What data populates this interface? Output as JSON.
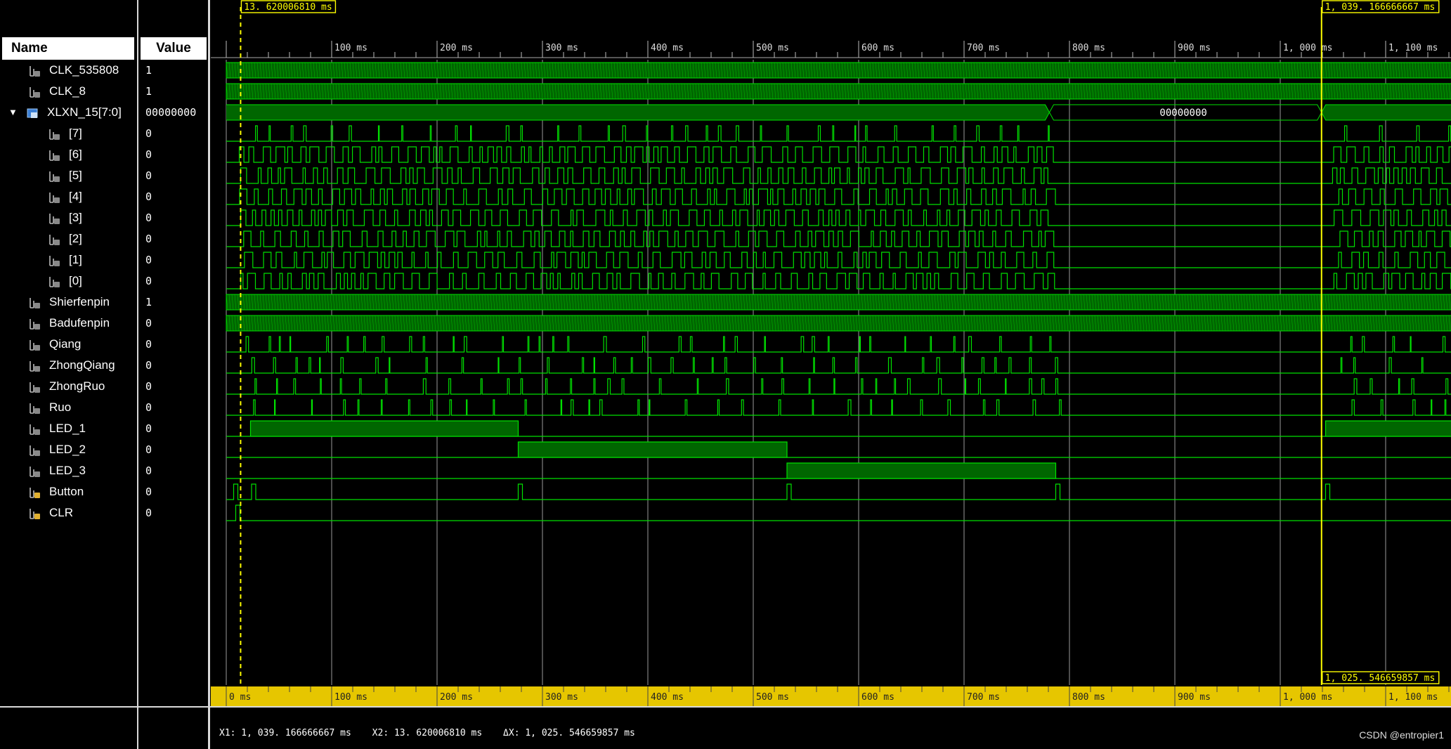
{
  "headers": {
    "name": "Name",
    "value": "Value"
  },
  "signals": [
    {
      "name": "CLK_535808",
      "value": "1",
      "indent": 0,
      "kind": "bit",
      "wave": "clock"
    },
    {
      "name": "CLK_8",
      "value": "1",
      "indent": 0,
      "kind": "bit",
      "wave": "clock"
    },
    {
      "name": "XLXN_15[7:0]",
      "value": "00000000",
      "indent": -1,
      "kind": "bus",
      "wave": "bus",
      "expanded": true
    },
    {
      "name": "[7]",
      "value": "0",
      "indent": 1,
      "kind": "bit",
      "wave": "sparse"
    },
    {
      "name": "[6]",
      "value": "0",
      "indent": 1,
      "kind": "bit",
      "wave": "pulses"
    },
    {
      "name": "[5]",
      "value": "0",
      "indent": 1,
      "kind": "bit",
      "wave": "pulses"
    },
    {
      "name": "[4]",
      "value": "0",
      "indent": 1,
      "kind": "bit",
      "wave": "pulses"
    },
    {
      "name": "[3]",
      "value": "0",
      "indent": 1,
      "kind": "bit",
      "wave": "pulses"
    },
    {
      "name": "[2]",
      "value": "0",
      "indent": 1,
      "kind": "bit",
      "wave": "pulses"
    },
    {
      "name": "[1]",
      "value": "0",
      "indent": 1,
      "kind": "bit",
      "wave": "pulses"
    },
    {
      "name": "[0]",
      "value": "0",
      "indent": 1,
      "kind": "bit",
      "wave": "pulses"
    },
    {
      "name": "Shierfenpin",
      "value": "1",
      "indent": 0,
      "kind": "bit",
      "wave": "clock"
    },
    {
      "name": "Badufenpin",
      "value": "0",
      "indent": 0,
      "kind": "bit",
      "wave": "clock"
    },
    {
      "name": "Qiang",
      "value": "0",
      "indent": 0,
      "kind": "bit",
      "wave": "sparse"
    },
    {
      "name": "ZhongQiang",
      "value": "0",
      "indent": 0,
      "kind": "bit",
      "wave": "sparse"
    },
    {
      "name": "ZhongRuo",
      "value": "0",
      "indent": 0,
      "kind": "bit",
      "wave": "sparse"
    },
    {
      "name": "Ruo",
      "value": "0",
      "indent": 0,
      "kind": "bit",
      "wave": "sparse"
    },
    {
      "name": "LED_1",
      "value": "0",
      "indent": 0,
      "kind": "bit",
      "wave": "led1"
    },
    {
      "name": "LED_2",
      "value": "0",
      "indent": 0,
      "kind": "bit",
      "wave": "led2"
    },
    {
      "name": "LED_3",
      "value": "0",
      "indent": 0,
      "kind": "bit",
      "wave": "led3"
    },
    {
      "name": "Button",
      "value": "0",
      "indent": 0,
      "kind": "input",
      "wave": "button"
    },
    {
      "name": "CLR",
      "value": "0",
      "indent": 0,
      "kind": "input",
      "wave": "clr"
    }
  ],
  "timeline": {
    "tick_labels": [
      "0 ms",
      "100 ms",
      "200 ms",
      "300 ms",
      "400 ms",
      "500 ms",
      "600 ms",
      "700 ms",
      "800 ms",
      "900 ms",
      "1, 000 ms",
      "1, 100 ms"
    ],
    "top_tick_labels": [
      "100 ms",
      "200 ms",
      "300 ms",
      "400 ms",
      "500 ms",
      "600 ms",
      "700 ms",
      "800 ms",
      "900 ms",
      "1, 000 ms",
      "1, 100 ms"
    ],
    "max_ms": 1170,
    "cursor1_ms": 13.62,
    "cursor2_ms": 1039.17,
    "cursor1_label": "13. 620006810 ms",
    "cursor2_label": "1, 039. 166666667 ms",
    "delta_label": "1, 025. 546659857 ms",
    "bus_value": "00000000",
    "led1_high": [
      [
        23,
        277
      ],
      [
        1043,
        1170
      ]
    ],
    "led2_high": [
      [
        277,
        532
      ],
      [
        1170,
        1170
      ]
    ],
    "led3_high": [
      [
        532,
        787
      ]
    ],
    "button_pulses": [
      7,
      24,
      277,
      532,
      787,
      1043
    ]
  },
  "status": {
    "x1": "X1: 1, 039. 166666667 ms",
    "x2": "X2: 13. 620006810 ms",
    "dx": "ΔX: 1, 025. 546659857 ms"
  },
  "watermark": "CSDN @entropier1",
  "colors": {
    "wave": "#00e000",
    "fill": "#006600",
    "cursor": "#ffff00",
    "ruler": "#e6c600",
    "grid": "#9a9a9a"
  }
}
